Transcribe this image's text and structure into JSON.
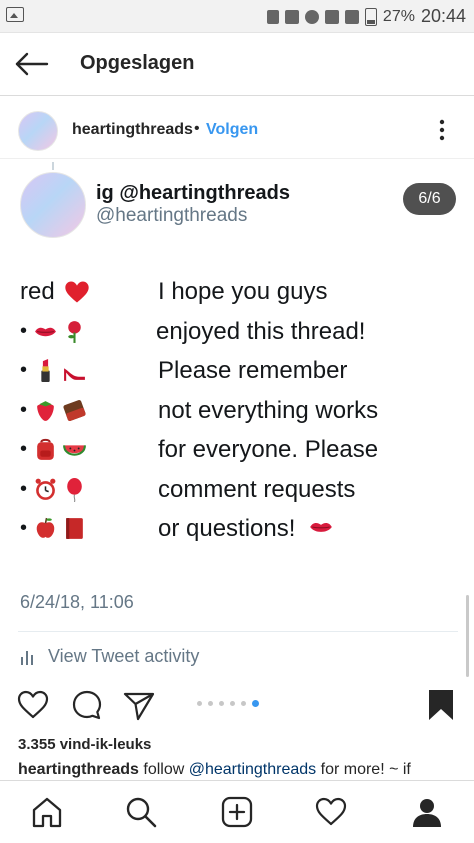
{
  "status_bar": {
    "battery": "27%",
    "time": "20:44"
  },
  "appbar": {
    "title": "Opgeslagen"
  },
  "post": {
    "username": "heartingthreads",
    "separator": "•",
    "follow_label": "Volgen",
    "likes": "3.355 vind-ik-leuks",
    "caption_user": "heartingthreads",
    "caption_follow": "follow",
    "caption_mention": "@heartingthreads",
    "caption_rest": "for more! ~ if",
    "carousel_total": 6,
    "carousel_active": 6
  },
  "tweet": {
    "name": "ig @heartingthreads",
    "handle": "@heartingthreads",
    "counter": "6/6",
    "left_col": {
      "first": "red",
      "bullet": "•"
    },
    "right_col": [
      "I hope you guys",
      "enjoyed this thread!",
      "Please remember",
      "not everything works",
      "for everyone. Please",
      "comment requests",
      "or questions!"
    ],
    "time": "6/24/18, 11:06",
    "activity": "View Tweet activity"
  },
  "icons": {
    "left_rows": [
      [
        "lips-icon",
        "rose-icon"
      ],
      [
        "lipstick-icon",
        "high-heel-icon"
      ],
      [
        "strawberry-icon",
        "chocolate-bar-icon"
      ],
      [
        "backpack-icon",
        "watermelon-icon"
      ],
      [
        "alarm-clock-icon",
        "balloon-icon"
      ],
      [
        "apple-icon",
        "red-book-icon"
      ]
    ]
  },
  "colors": {
    "accent": "#3897f0",
    "counter_bg": "#505050",
    "tweet_secondary": "#657786"
  }
}
